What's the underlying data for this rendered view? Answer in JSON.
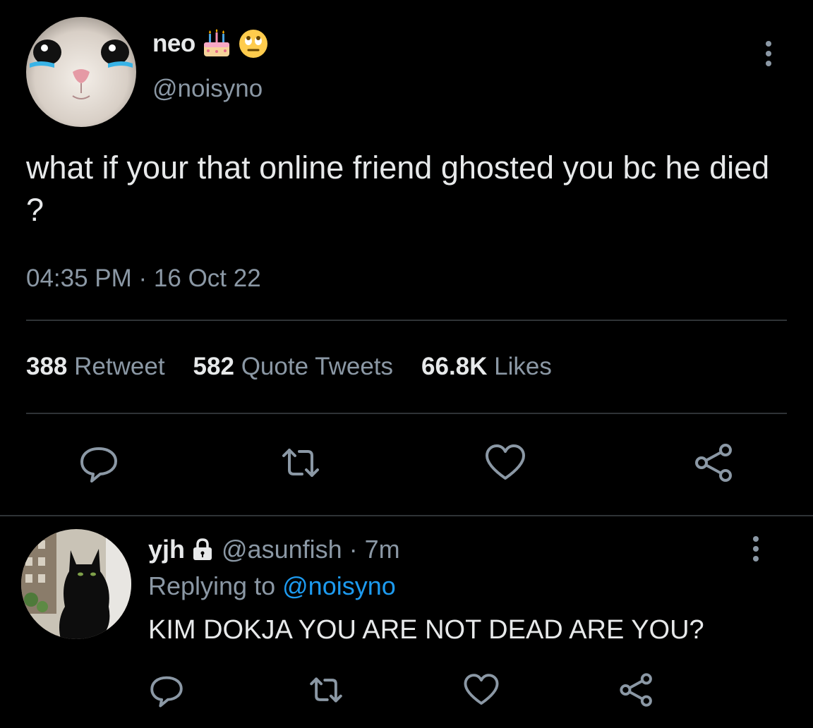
{
  "main_tweet": {
    "author": {
      "display_name": "neo",
      "handle": "@noisyno",
      "avatar": "crying-cat-avatar",
      "emojis": [
        "birthday-cake-emoji",
        "eye-roll-emoji"
      ]
    },
    "text": "what if your that online friend ghosted you bc he died ?",
    "timestamp": "04:35 PM · 16 Oct 22",
    "stats": {
      "retweets": {
        "count": "388",
        "label": "Retweet"
      },
      "quotes": {
        "count": "582",
        "label": "Quote Tweets"
      },
      "likes": {
        "count": "66.8K",
        "label": "Likes"
      }
    },
    "actions": [
      "reply-icon",
      "retweet-icon",
      "like-icon",
      "share-icon"
    ]
  },
  "reply": {
    "author": {
      "display_name": "yjh",
      "handle_time": "@asunfish · 7m",
      "protected": true,
      "avatar": "black-cat-avatar"
    },
    "replying_prefix": "Replying to",
    "replying_to": "@noisyno",
    "text": "KIM DOKJA YOU ARE NOT DEAD ARE YOU?",
    "actions": [
      "reply-icon",
      "retweet-icon",
      "like-icon",
      "share-icon"
    ]
  },
  "colors": {
    "background": "#000000",
    "text_primary": "#e7e9ea",
    "text_secondary": "#8b98a5",
    "link": "#1d9bf0",
    "divider": "#2f3336"
  }
}
